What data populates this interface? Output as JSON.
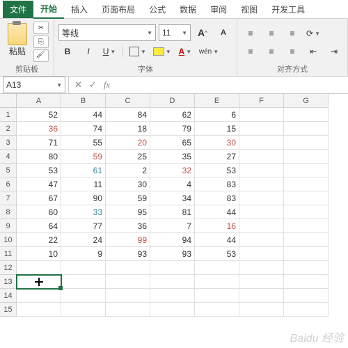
{
  "tabs": {
    "file": "文件",
    "home": "开始",
    "insert": "插入",
    "layout": "页面布局",
    "formula": "公式",
    "data": "数据",
    "review": "审阅",
    "view": "视图",
    "dev": "开发工具"
  },
  "ribbon": {
    "paste": "粘贴",
    "clipboard_label": "剪贴板",
    "font_name": "等线",
    "font_size": "11",
    "grow": "A",
    "shrink": "A",
    "bold": "B",
    "italic": "I",
    "underline": "U",
    "font_color": "A",
    "phonetic": "wén",
    "font_label": "字体",
    "align_label": "对齐方式"
  },
  "namebox": "A13",
  "formula": "",
  "columns": [
    "A",
    "B",
    "C",
    "D",
    "E",
    "F",
    "G"
  ],
  "rows": [
    1,
    2,
    3,
    4,
    5,
    6,
    7,
    8,
    9,
    10,
    11,
    12,
    13,
    14,
    15
  ],
  "cells": {
    "r1": [
      {
        "v": "52"
      },
      {
        "v": "44"
      },
      {
        "v": "84"
      },
      {
        "v": "62"
      },
      {
        "v": "6"
      }
    ],
    "r2": [
      {
        "v": "36",
        "c": "red"
      },
      {
        "v": "74"
      },
      {
        "v": "18"
      },
      {
        "v": "79"
      },
      {
        "v": "15"
      }
    ],
    "r3": [
      {
        "v": "71"
      },
      {
        "v": "55"
      },
      {
        "v": "20",
        "c": "red"
      },
      {
        "v": "65"
      },
      {
        "v": "30",
        "c": "red"
      }
    ],
    "r4": [
      {
        "v": "80"
      },
      {
        "v": "59",
        "c": "red"
      },
      {
        "v": "25"
      },
      {
        "v": "35"
      },
      {
        "v": "27"
      }
    ],
    "r5": [
      {
        "v": "53"
      },
      {
        "v": "61",
        "c": "teal"
      },
      {
        "v": "2"
      },
      {
        "v": "32",
        "c": "red"
      },
      {
        "v": "53"
      }
    ],
    "r6": [
      {
        "v": "47"
      },
      {
        "v": "11"
      },
      {
        "v": "30"
      },
      {
        "v": "4"
      },
      {
        "v": "83"
      }
    ],
    "r7": [
      {
        "v": "67"
      },
      {
        "v": "90"
      },
      {
        "v": "59"
      },
      {
        "v": "34"
      },
      {
        "v": "83"
      }
    ],
    "r8": [
      {
        "v": "60"
      },
      {
        "v": "33",
        "c": "teal"
      },
      {
        "v": "95"
      },
      {
        "v": "81"
      },
      {
        "v": "44"
      }
    ],
    "r9": [
      {
        "v": "64"
      },
      {
        "v": "77"
      },
      {
        "v": "36"
      },
      {
        "v": "7"
      },
      {
        "v": "16",
        "c": "red"
      }
    ],
    "r10": [
      {
        "v": "22"
      },
      {
        "v": "24"
      },
      {
        "v": "99",
        "c": "red"
      },
      {
        "v": "94"
      },
      {
        "v": "44"
      }
    ],
    "r11": [
      {
        "v": "10"
      },
      {
        "v": "9"
      },
      {
        "v": "93"
      },
      {
        "v": "93"
      },
      {
        "v": "53"
      }
    ]
  },
  "selected": {
    "row": 13,
    "col": "A"
  },
  "watermark": "Baidu 经验"
}
